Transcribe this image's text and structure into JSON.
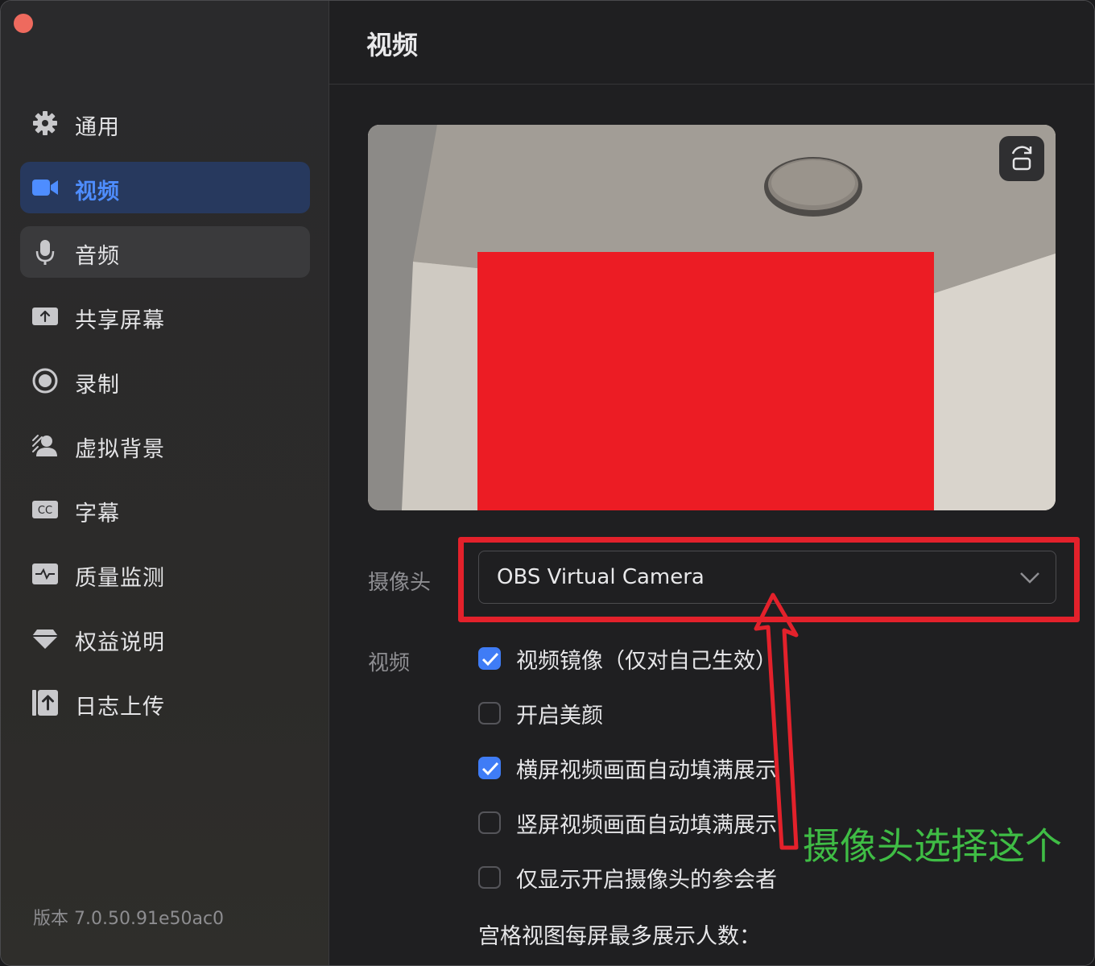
{
  "sidebar": {
    "items": [
      {
        "label": "通用",
        "icon": "gear-icon"
      },
      {
        "label": "视频",
        "icon": "video-camera-icon"
      },
      {
        "label": "音频",
        "icon": "microphone-icon"
      },
      {
        "label": "共享屏幕",
        "icon": "share-screen-icon"
      },
      {
        "label": "录制",
        "icon": "record-icon"
      },
      {
        "label": "虚拟背景",
        "icon": "virtual-background-icon"
      },
      {
        "label": "字幕",
        "icon": "closed-caption-icon"
      },
      {
        "label": "质量监测",
        "icon": "pulse-monitor-icon"
      },
      {
        "label": "权益说明",
        "icon": "diamond-icon"
      },
      {
        "label": "日志上传",
        "icon": "upload-log-icon"
      }
    ],
    "active_index": 1,
    "version": "版本 7.0.50.91e50ac0"
  },
  "main": {
    "title": "视频",
    "camera_label": "摄像头",
    "camera_value": "OBS Virtual Camera",
    "video_label": "视频",
    "options": [
      {
        "label": "视频镜像（仅对自己生效）",
        "checked": true
      },
      {
        "label": "开启美颜",
        "checked": false
      },
      {
        "label": "横屏视频画面自动填满展示",
        "checked": true
      },
      {
        "label": "竖屏视频画面自动填满展示",
        "checked": false
      },
      {
        "label": "仅显示开启摄像头的参会者",
        "checked": false
      }
    ],
    "grid_label": "宫格视图每屏最多展示人数："
  },
  "annotation": {
    "text": "摄像头选择这个",
    "box_color": "#e3212b",
    "text_color": "#3fbd45"
  },
  "colors": {
    "accent": "#3f7cf6",
    "active_nav_bg": "#27395e",
    "active_nav_text": "#4e8dff",
    "redaction": "#ec1c24"
  }
}
